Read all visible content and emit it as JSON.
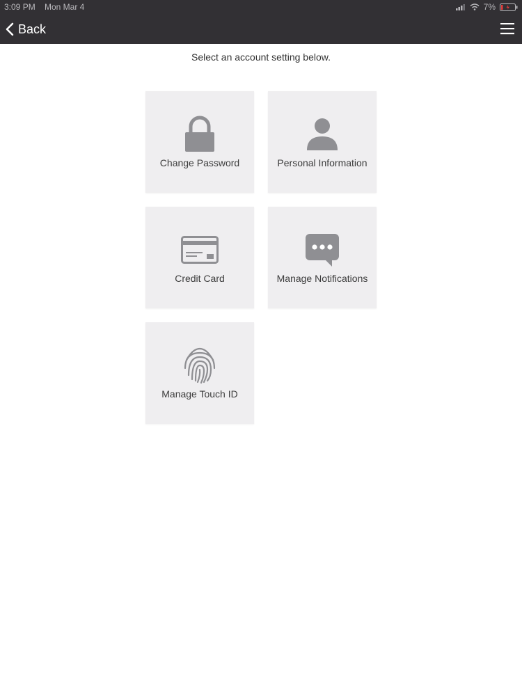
{
  "status_bar": {
    "time": "3:09 PM",
    "date": "Mon Mar 4",
    "battery": "7%"
  },
  "nav": {
    "back_label": "Back"
  },
  "subtitle": "Select an account setting below.",
  "tiles": [
    {
      "label": "Change Password",
      "icon": "lock-icon"
    },
    {
      "label": "Personal Information",
      "icon": "person-icon"
    },
    {
      "label": "Credit Card",
      "icon": "credit-card-icon"
    },
    {
      "label": "Manage Notifications",
      "icon": "chat-bubble-icon"
    },
    {
      "label": "Manage Touch ID",
      "icon": "fingerprint-icon"
    }
  ],
  "colors": {
    "nav_background": "#323034",
    "tile_background": "#efeef0",
    "icon": "#8f8f93",
    "battery_low": "#e23b3b"
  }
}
